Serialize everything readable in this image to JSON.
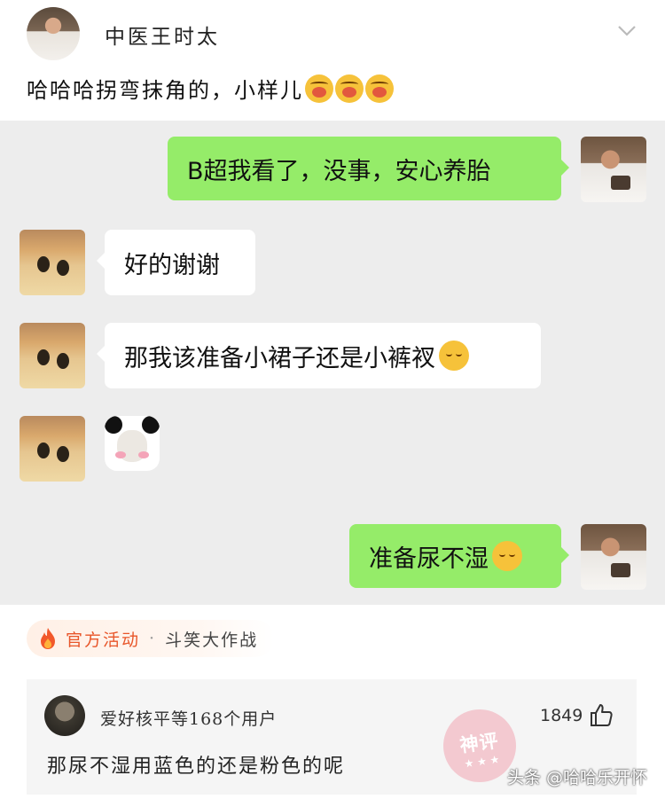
{
  "post": {
    "author": "中医王时太",
    "text": "哈哈哈拐弯抹角的，小样儿",
    "emojis": [
      "drooling-face-icon",
      "drooling-face-icon",
      "drooling-face-icon"
    ]
  },
  "chat": {
    "messages": [
      {
        "side": "right",
        "text": "B超我看了，没事，安心养胎"
      },
      {
        "side": "left",
        "text": "好的谢谢"
      },
      {
        "side": "left",
        "text": "那我该准备小裙子还是小裤衩",
        "emoji": "smiling-closed-eyes-icon"
      },
      {
        "side": "left",
        "sticker": "panda-face-sticker"
      },
      {
        "side": "right",
        "text": "准备尿不湿",
        "emoji": "eye-roll-icon"
      }
    ],
    "colors": {
      "me_bubble": "#95ec69",
      "other_bubble": "#ffffff",
      "background": "#ededed"
    }
  },
  "activity": {
    "label": "官方活动",
    "separator": "·",
    "name": "斗笑大作战",
    "accent": "#e8562a"
  },
  "comment": {
    "user": "爱好核平等168个用户",
    "likes": "1849",
    "text": "那尿不湿用蓝色的还是粉色的呢",
    "stamp": "神评"
  },
  "watermark": "头条 @哈哈乐开怀"
}
